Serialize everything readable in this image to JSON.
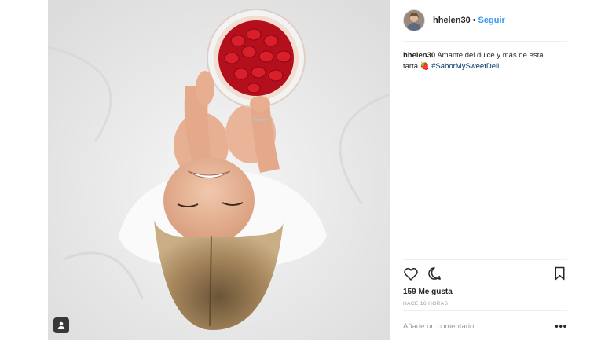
{
  "post": {
    "author": {
      "username": "hhelen30",
      "separator": "•",
      "follow_label": "Seguir"
    },
    "caption": {
      "username": "hhelen30",
      "text": "Amante del dulce y más de esta tarta",
      "emoji": "🍓",
      "hashtag": "#SaborMySweetDeli"
    },
    "likes_label": "159 Me gusta",
    "timestamp": "HACE 16 HORAS",
    "comment": {
      "placeholder": "Añade un comentario...",
      "value": ""
    },
    "icons": {
      "like": "heart-icon",
      "comment": "comment-icon",
      "save": "bookmark-icon",
      "tagged_user": "user-tag-icon",
      "options": "more-options-icon"
    },
    "more_label": "•••",
    "colors": {
      "link_blue": "#3897f0",
      "hashtag": "#003569",
      "text": "#262626",
      "muted": "#999999",
      "border": "#efefef"
    }
  }
}
